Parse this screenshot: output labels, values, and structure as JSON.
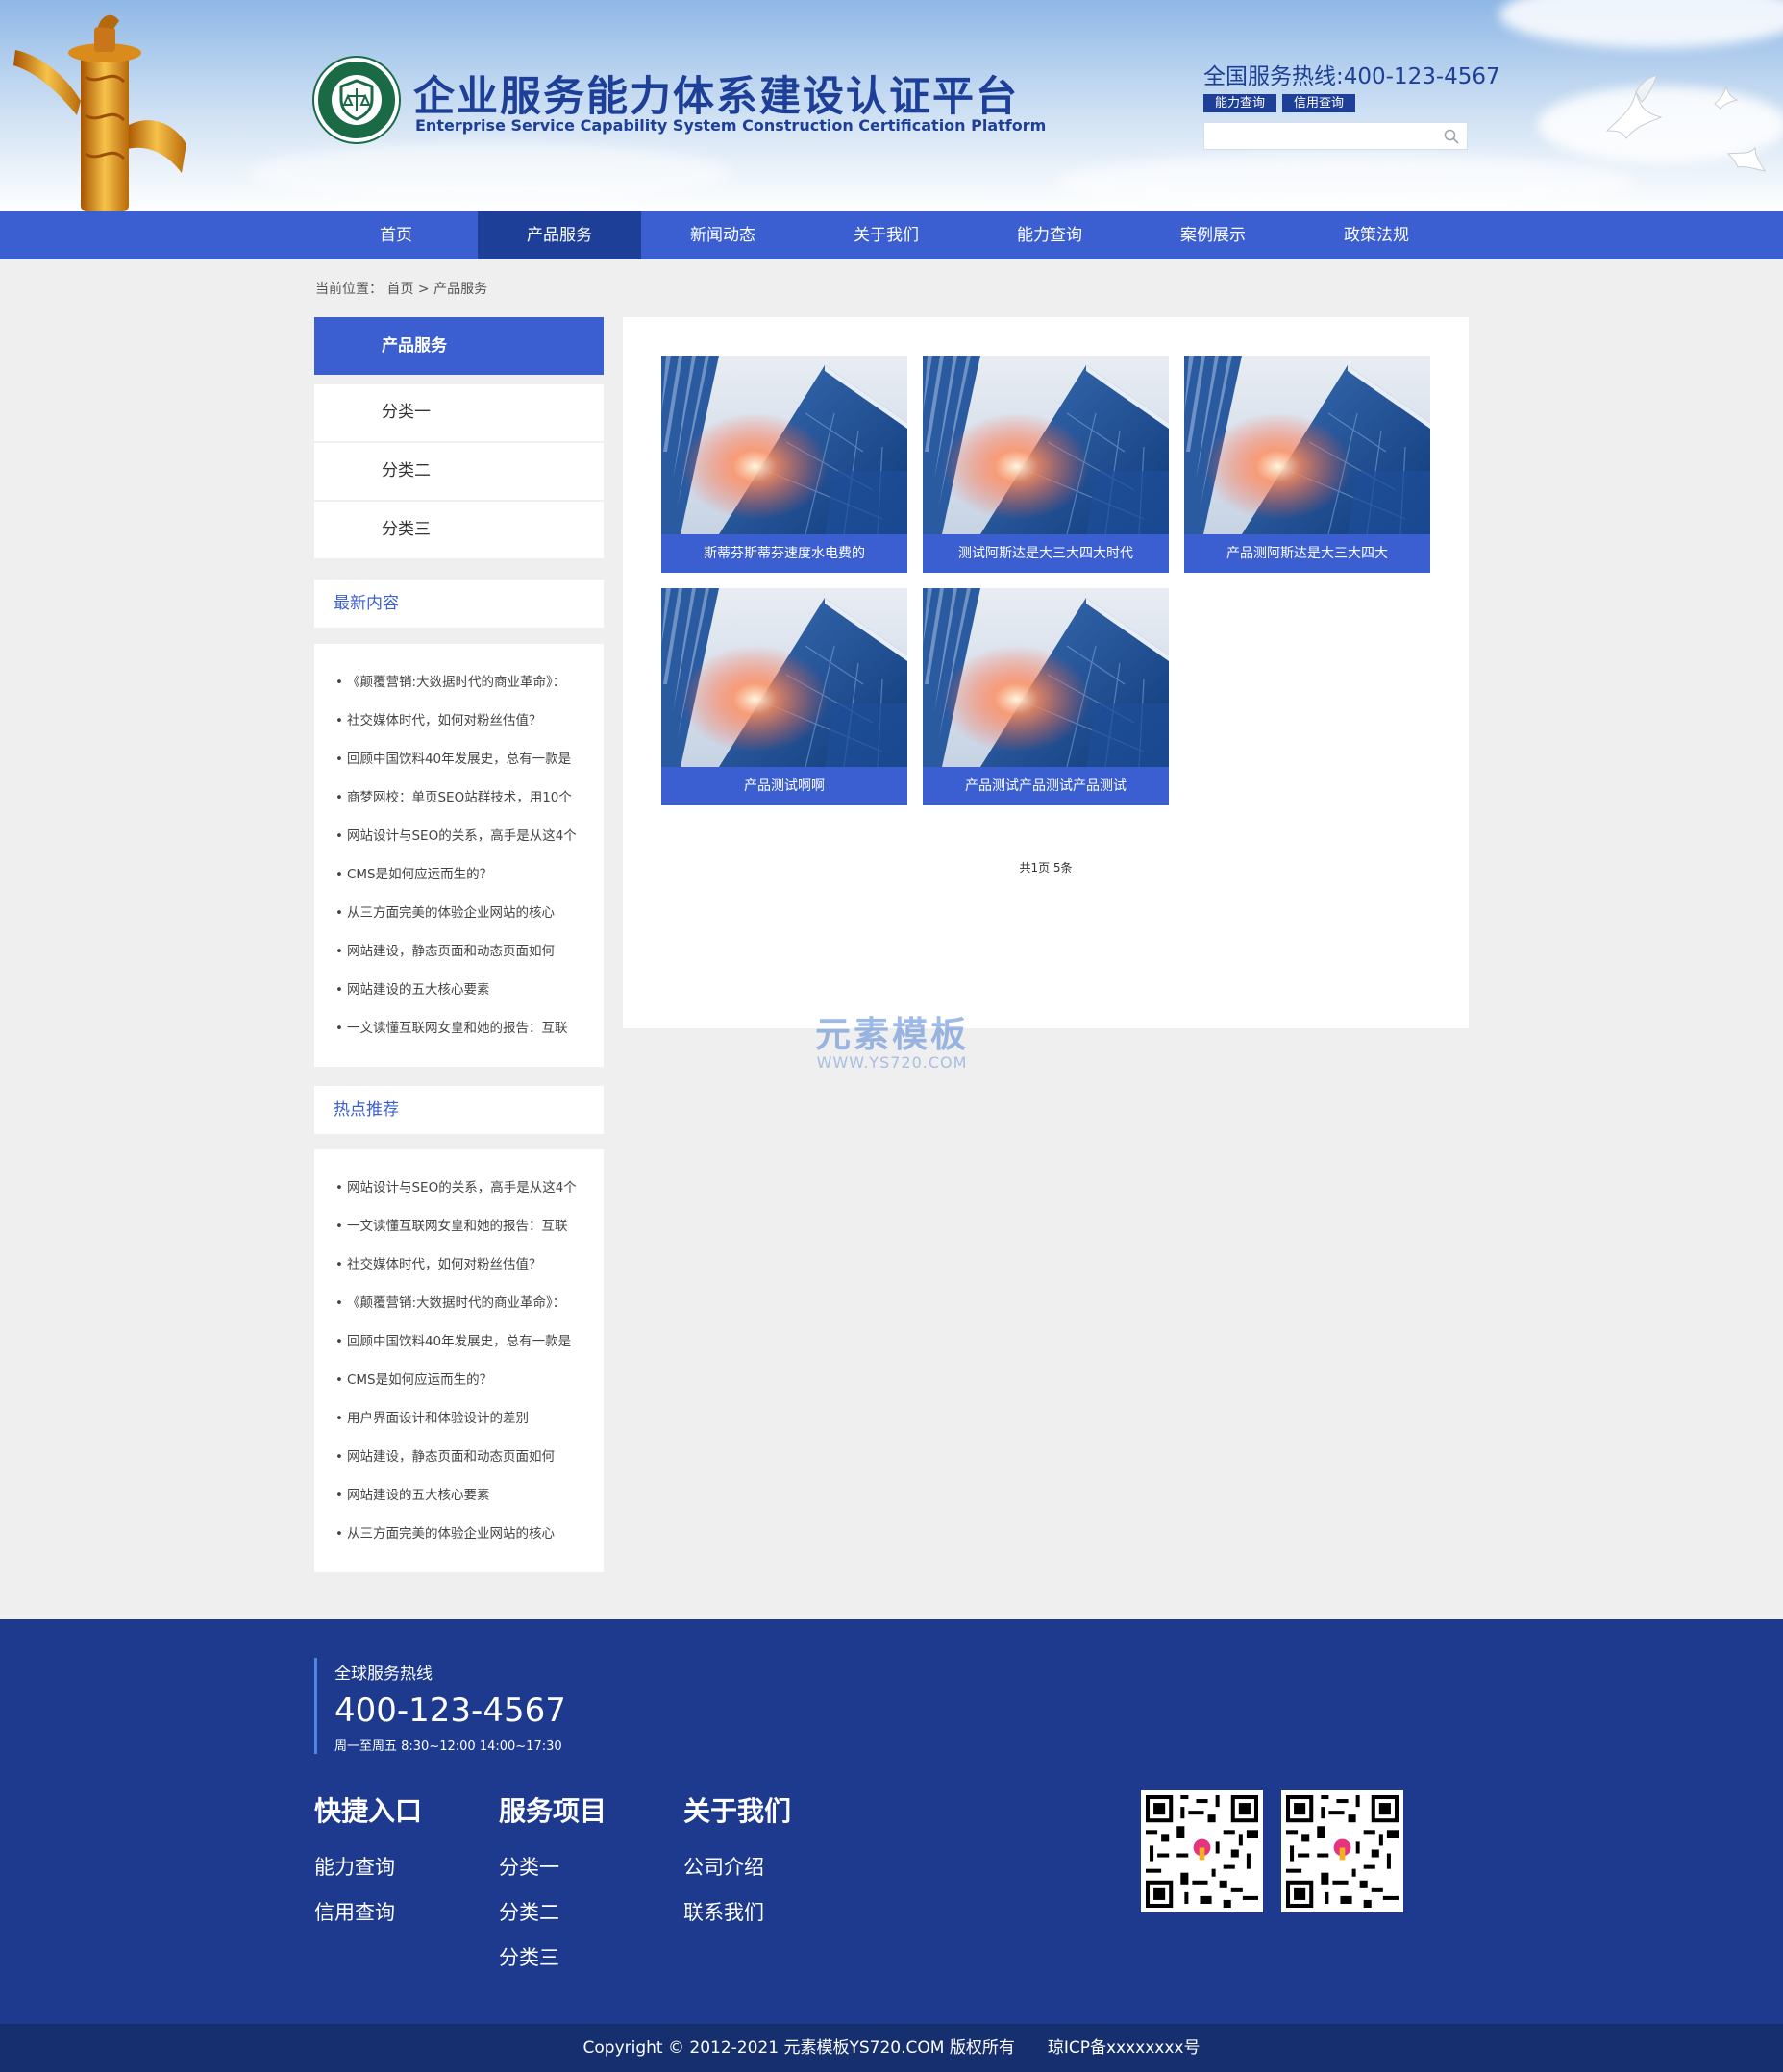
{
  "header": {
    "title": "企业服务能力体系建设认证平台",
    "subtitle": "Enterprise Service Capability System Construction Certification Platform",
    "hotline": "全国服务热线:400-123-4567",
    "buttons": [
      "能力查询",
      "信用查询"
    ],
    "search": {
      "placeholder": ""
    }
  },
  "nav": {
    "items": [
      "首页",
      "产品服务",
      "新闻动态",
      "关于我们",
      "能力查询",
      "案例展示",
      "政策法规"
    ],
    "active_index": 1
  },
  "breadcrumb": "当前位置： 首页 > 产品服务",
  "sidebar": {
    "section_title": "产品服务",
    "categories": [
      "分类一",
      "分类二",
      "分类三"
    ],
    "latest": {
      "title": "最新内容",
      "items": [
        "《颠覆营销:大数据时代的商业革命》：",
        "社交媒体时代，如何对粉丝估值？",
        "回顾中国饮料40年发展史，总有一款是",
        "商梦网校：单页SEO站群技术，用10个",
        "网站设计与SEO的关系，高手是从这4个",
        "CMS是如何应运而生的？",
        "从三方面完美的体验企业网站的核心",
        "网站建设，静态页面和动态页面如何",
        "网站建设的五大核心要素",
        "一文读懂互联网女皇和她的报告：互联"
      ]
    },
    "hot": {
      "title": "热点推荐",
      "items": [
        "网站设计与SEO的关系，高手是从这4个",
        "一文读懂互联网女皇和她的报告：互联",
        "社交媒体时代，如何对粉丝估值？",
        "《颠覆营销:大数据时代的商业革命》：",
        "回顾中国饮料40年发展史，总有一款是",
        "CMS是如何应运而生的？",
        "用户界面设计和体验设计的差别",
        "网站建设，静态页面和动态页面如何",
        "网站建设的五大核心要素",
        "从三方面完美的体验企业网站的核心"
      ]
    }
  },
  "products": [
    {
      "caption": "斯蒂芬斯蒂芬速度水电费的"
    },
    {
      "caption": "测试阿斯达是大三大四大时代"
    },
    {
      "caption": "产品测阿斯达是大三大四大"
    },
    {
      "caption": "产品测试啊啊"
    },
    {
      "caption": "产品测试产品测试产品测试"
    }
  ],
  "pagination": {
    "text": "共1页 5条"
  },
  "watermark": {
    "line1": "元素模板",
    "line2": "WWW.YS720.COM"
  },
  "footer": {
    "hotline_label": "全球服务热线",
    "hotline_number": "400-123-4567",
    "hours": "周一至周五 8:30~12:00 14:00~17:30",
    "columns": [
      {
        "title": "快捷入口",
        "links": [
          "能力查询",
          "信用查询"
        ]
      },
      {
        "title": "服务项目",
        "links": [
          "分类一",
          "分类二",
          "分类三"
        ]
      },
      {
        "title": "关于我们",
        "links": [
          "公司介绍",
          "联系我们"
        ]
      }
    ],
    "copyright": "Copyright © 2012-2021 元素模板YS720.COM 版权所有",
    "icp": "琼ICP备xxxxxxxx号"
  },
  "colors": {
    "brand_blue": "#3b5fd0",
    "dark_blue": "#1d3f97",
    "footer_blue": "#1d3a8f",
    "copyright_bar": "#16306f",
    "page_bg": "#efefef"
  },
  "icons": [
    "huabiao-pillar",
    "dove",
    "certification-seal-logo",
    "search-icon",
    "building-photo",
    "qr-code"
  ]
}
